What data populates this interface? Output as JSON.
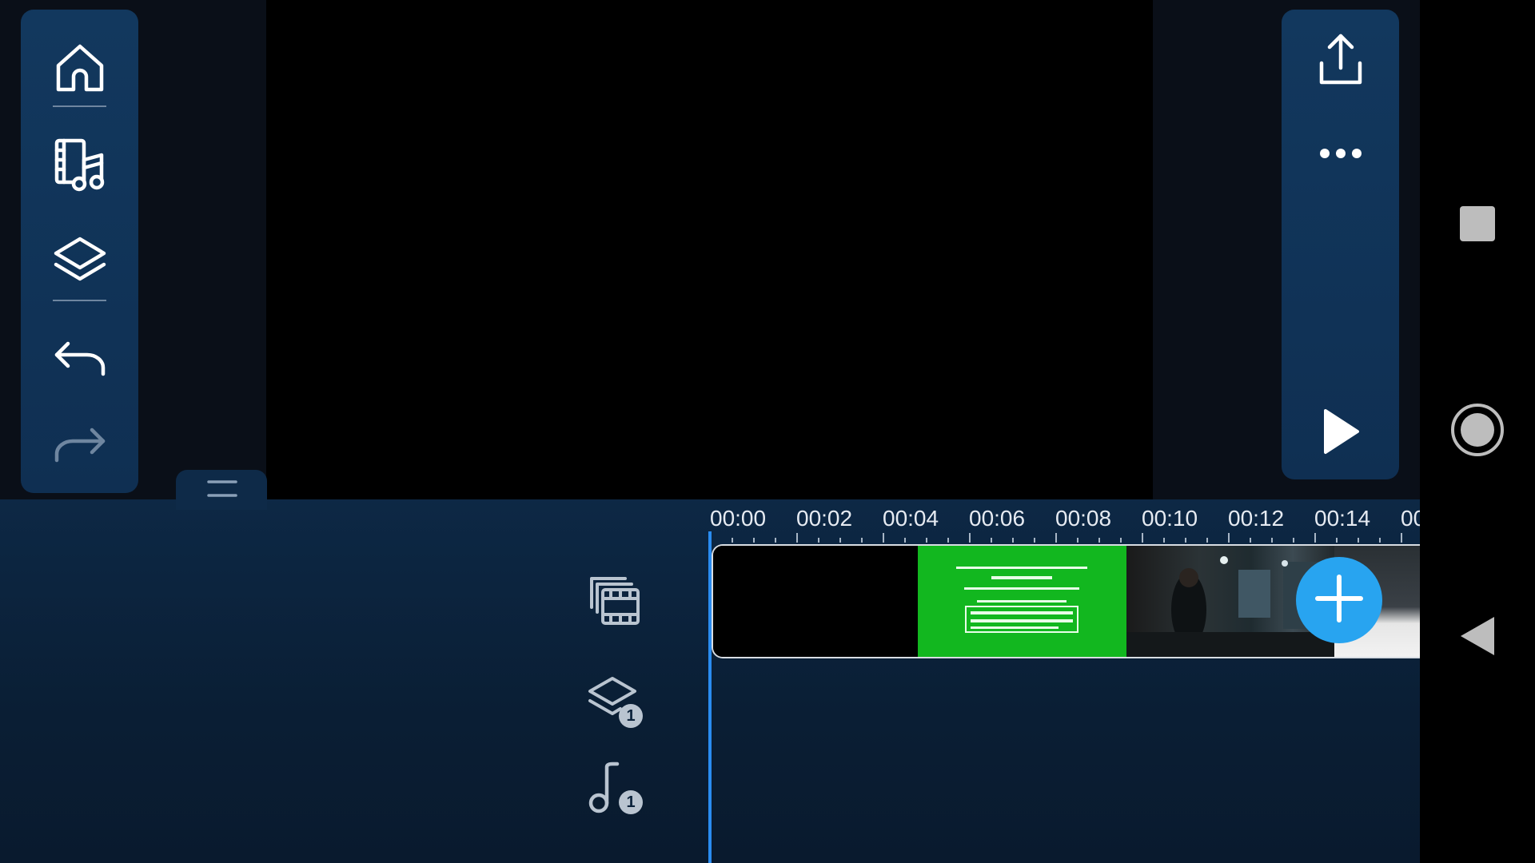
{
  "app": {
    "left_toolbar": {
      "buttons": [
        {
          "icon": "home-icon"
        },
        {
          "icon": "media-library-icon"
        },
        {
          "icon": "layers-icon"
        },
        {
          "icon": "undo-icon"
        },
        {
          "icon": "redo-icon",
          "disabled": true
        }
      ]
    },
    "right_toolbar": {
      "buttons": [
        {
          "icon": "export-icon"
        },
        {
          "icon": "more-icon"
        },
        {
          "icon": "play-icon"
        }
      ]
    },
    "timeline": {
      "ruler_labels": [
        "00:00",
        "00:02",
        "00:04",
        "00:06",
        "00:08",
        "00:10",
        "00:12",
        "00:14",
        "00"
      ],
      "track_icons": [
        {
          "icon": "video-track-icon"
        },
        {
          "icon": "layer-track-icon",
          "badge": "1"
        },
        {
          "icon": "audio-track-icon",
          "badge": "1"
        }
      ],
      "clip_segments": [
        "black-frame",
        "green-screen-text",
        "dark-scene",
        "bright-scene"
      ],
      "add_button_icon": "plus-icon"
    },
    "colors": {
      "toolbar": "#12385e",
      "accent": "#28a4f0",
      "playhead": "#2a8cf0",
      "green_screen": "#12b71f"
    }
  },
  "navigation_bar": {
    "buttons": [
      {
        "icon": "recents-square-icon"
      },
      {
        "icon": "home-circle-icon"
      },
      {
        "icon": "back-triangle-icon"
      }
    ]
  }
}
